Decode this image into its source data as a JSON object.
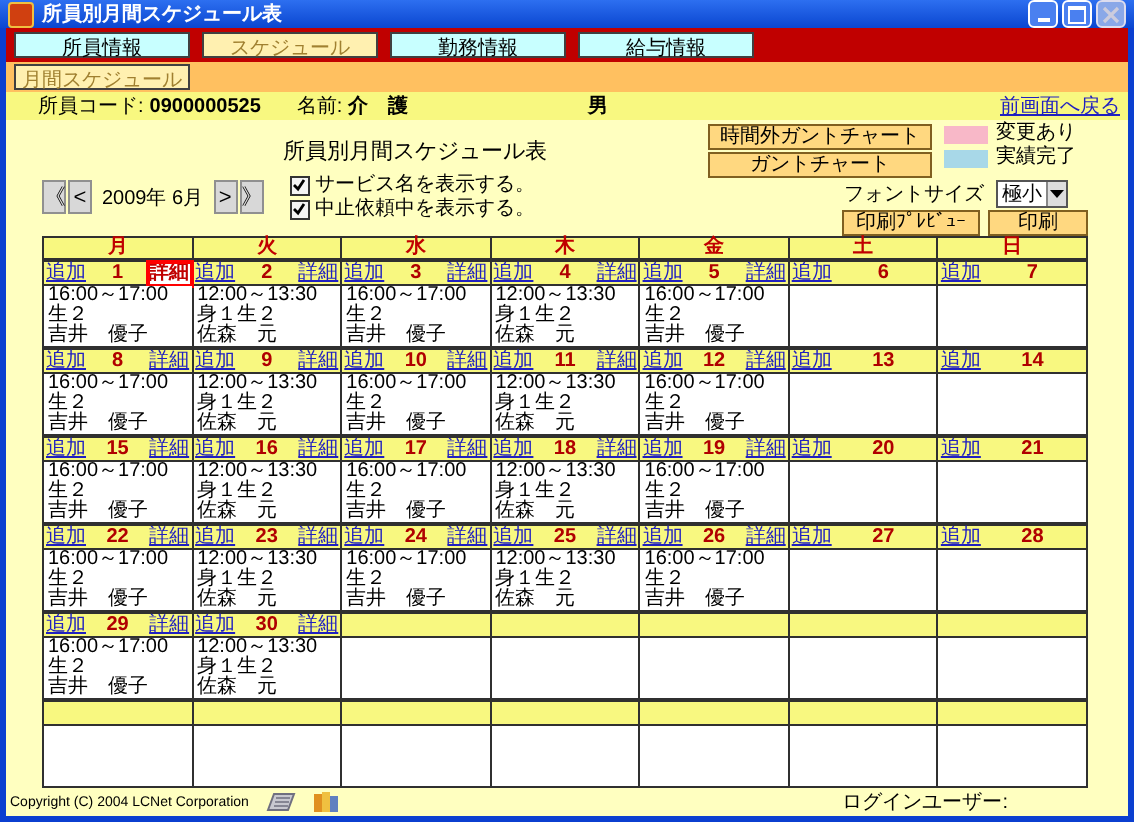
{
  "window": {
    "title": "所員別月間スケジュール表"
  },
  "main_tabs": [
    {
      "label": "所員情報",
      "selected": false
    },
    {
      "label": "スケジュール",
      "selected": true
    },
    {
      "label": "勤務情報",
      "selected": false
    },
    {
      "label": "給与情報",
      "selected": false
    }
  ],
  "sub_tabs": [
    {
      "label": "月間スケジュール",
      "selected": true
    }
  ],
  "staff": {
    "code_label": "所員コード:",
    "code": "0900000525",
    "name_label": "名前:",
    "name": "介　護",
    "gender": "男"
  },
  "back_link": "前画面へ戻る",
  "heading": "所員別月間スケジュール表",
  "chart_buttons": [
    "時間外ガントチャート",
    "ガントチャート"
  ],
  "legend": [
    {
      "label": "変更あり",
      "color": "#f8b8c8"
    },
    {
      "label": "実績完了",
      "color": "#a8d8e8"
    }
  ],
  "font_size": {
    "label": "フォントサイズ",
    "value": "極小"
  },
  "print_buttons": [
    "印刷ﾌﾟﾚﾋﾞｭｰ",
    "印刷"
  ],
  "nav": {
    "prev": [
      "《",
      "<"
    ],
    "month": "2009年 6月",
    "next": [
      ">",
      "》"
    ]
  },
  "options": [
    {
      "label": "サービス名を表示する。",
      "checked": true
    },
    {
      "label": "中止依頼中を表示する。",
      "checked": true
    }
  ],
  "weekdays": [
    "月",
    "火",
    "水",
    "木",
    "金",
    "土",
    "日"
  ],
  "weeks": [
    {
      "days": [
        {
          "kind": "day",
          "day": "1",
          "add": "追加",
          "detail": {
            "label": "詳細",
            "selected": true
          },
          "events": [
            {
              "time": "16:00～17:00生２",
              "staff": "吉井　優子"
            }
          ]
        },
        {
          "kind": "day",
          "day": "2",
          "add": "追加",
          "detail": {
            "label": "詳細",
            "selected": false
          },
          "events": [
            {
              "time": "12:00～13:30身１生２",
              "staff": "佐森　元"
            }
          ]
        },
        {
          "kind": "day",
          "day": "3",
          "add": "追加",
          "detail": {
            "label": "詳細",
            "selected": false
          },
          "events": [
            {
              "time": "16:00～17:00生２",
              "staff": "吉井　優子"
            }
          ]
        },
        {
          "kind": "day",
          "day": "4",
          "add": "追加",
          "detail": {
            "label": "詳細",
            "selected": false
          },
          "events": [
            {
              "time": "12:00～13:30身１生２",
              "staff": "佐森　元"
            }
          ]
        },
        {
          "kind": "day",
          "day": "5",
          "add": "追加",
          "detail": {
            "label": "詳細",
            "selected": false
          },
          "events": [
            {
              "time": "16:00～17:00生２",
              "staff": "吉井　優子"
            }
          ]
        },
        {
          "kind": "day",
          "day": "6",
          "add": "追加"
        },
        {
          "kind": "day",
          "day": "7",
          "add": "追加"
        }
      ]
    },
    {
      "days": [
        {
          "kind": "day",
          "day": "8",
          "add": "追加",
          "detail": {
            "label": "詳細",
            "selected": false
          },
          "events": [
            {
              "time": "16:00～17:00生２",
              "staff": "吉井　優子"
            }
          ]
        },
        {
          "kind": "day",
          "day": "9",
          "add": "追加",
          "detail": {
            "label": "詳細",
            "selected": false
          },
          "events": [
            {
              "time": "12:00～13:30身１生２",
              "staff": "佐森　元"
            }
          ]
        },
        {
          "kind": "day",
          "day": "10",
          "add": "追加",
          "detail": {
            "label": "詳細",
            "selected": false
          },
          "events": [
            {
              "time": "16:00～17:00生２",
              "staff": "吉井　優子"
            }
          ]
        },
        {
          "kind": "day",
          "day": "11",
          "add": "追加",
          "detail": {
            "label": "詳細",
            "selected": false
          },
          "events": [
            {
              "time": "12:00～13:30身１生２",
              "staff": "佐森　元"
            }
          ]
        },
        {
          "kind": "day",
          "day": "12",
          "add": "追加",
          "detail": {
            "label": "詳細",
            "selected": false
          },
          "events": [
            {
              "time": "16:00～17:00生２",
              "staff": "吉井　優子"
            }
          ]
        },
        {
          "kind": "day",
          "day": "13",
          "add": "追加"
        },
        {
          "kind": "day",
          "day": "14",
          "add": "追加"
        }
      ]
    },
    {
      "days": [
        {
          "kind": "day",
          "day": "15",
          "add": "追加",
          "detail": {
            "label": "詳細",
            "selected": false
          },
          "events": [
            {
              "time": "16:00～17:00生２",
              "staff": "吉井　優子"
            }
          ]
        },
        {
          "kind": "day",
          "day": "16",
          "add": "追加",
          "detail": {
            "label": "詳細",
            "selected": false
          },
          "events": [
            {
              "time": "12:00～13:30身１生２",
              "staff": "佐森　元"
            }
          ]
        },
        {
          "kind": "day",
          "day": "17",
          "add": "追加",
          "detail": {
            "label": "詳細",
            "selected": false
          },
          "events": [
            {
              "time": "16:00～17:00生２",
              "staff": "吉井　優子"
            }
          ]
        },
        {
          "kind": "day",
          "day": "18",
          "add": "追加",
          "detail": {
            "label": "詳細",
            "selected": false
          },
          "events": [
            {
              "time": "12:00～13:30身１生２",
              "staff": "佐森　元"
            }
          ]
        },
        {
          "kind": "day",
          "day": "19",
          "add": "追加",
          "detail": {
            "label": "詳細",
            "selected": false
          },
          "events": [
            {
              "time": "16:00～17:00生２",
              "staff": "吉井　優子"
            }
          ]
        },
        {
          "kind": "day",
          "day": "20",
          "add": "追加"
        },
        {
          "kind": "day",
          "day": "21",
          "add": "追加"
        }
      ]
    },
    {
      "days": [
        {
          "kind": "day",
          "day": "22",
          "add": "追加",
          "detail": {
            "label": "詳細",
            "selected": false
          },
          "events": [
            {
              "time": "16:00～17:00生２",
              "staff": "吉井　優子"
            }
          ]
        },
        {
          "kind": "day",
          "day": "23",
          "add": "追加",
          "detail": {
            "label": "詳細",
            "selected": false
          },
          "events": [
            {
              "time": "12:00～13:30身１生２",
              "staff": "佐森　元"
            }
          ]
        },
        {
          "kind": "day",
          "day": "24",
          "add": "追加",
          "detail": {
            "label": "詳細",
            "selected": false
          },
          "events": [
            {
              "time": "16:00～17:00生２",
              "staff": "吉井　優子"
            }
          ]
        },
        {
          "kind": "day",
          "day": "25",
          "add": "追加",
          "detail": {
            "label": "詳細",
            "selected": false
          },
          "events": [
            {
              "time": "12:00～13:30身１生２",
              "staff": "佐森　元"
            }
          ]
        },
        {
          "kind": "day",
          "day": "26",
          "add": "追加",
          "detail": {
            "label": "詳細",
            "selected": false
          },
          "events": [
            {
              "time": "16:00～17:00生２",
              "staff": "吉井　優子"
            }
          ]
        },
        {
          "kind": "day",
          "day": "27",
          "add": "追加"
        },
        {
          "kind": "day",
          "day": "28",
          "add": "追加"
        }
      ]
    },
    {
      "days": [
        {
          "kind": "day",
          "day": "29",
          "add": "追加",
          "detail": {
            "label": "詳細",
            "selected": false
          },
          "events": [
            {
              "time": "16:00～17:00生２",
              "staff": "吉井　優子"
            }
          ]
        },
        {
          "kind": "day",
          "day": "30",
          "add": "追加",
          "detail": {
            "label": "詳細",
            "selected": false
          },
          "events": [
            {
              "time": "12:00～13:30身１生２",
              "staff": "佐森　元"
            }
          ]
        },
        {
          "kind": "blank"
        },
        {
          "kind": "blank"
        },
        {
          "kind": "blank"
        },
        {
          "kind": "blank"
        },
        {
          "kind": "blank"
        }
      ]
    },
    {
      "days": [
        {
          "kind": "blank"
        },
        {
          "kind": "blank"
        },
        {
          "kind": "blank"
        },
        {
          "kind": "blank"
        },
        {
          "kind": "blank"
        },
        {
          "kind": "blank"
        },
        {
          "kind": "blank"
        }
      ]
    }
  ],
  "footer": {
    "copyright": "Copyright (C) 2004 LCNet Corporation",
    "login_label": "ログインユーザー:"
  }
}
